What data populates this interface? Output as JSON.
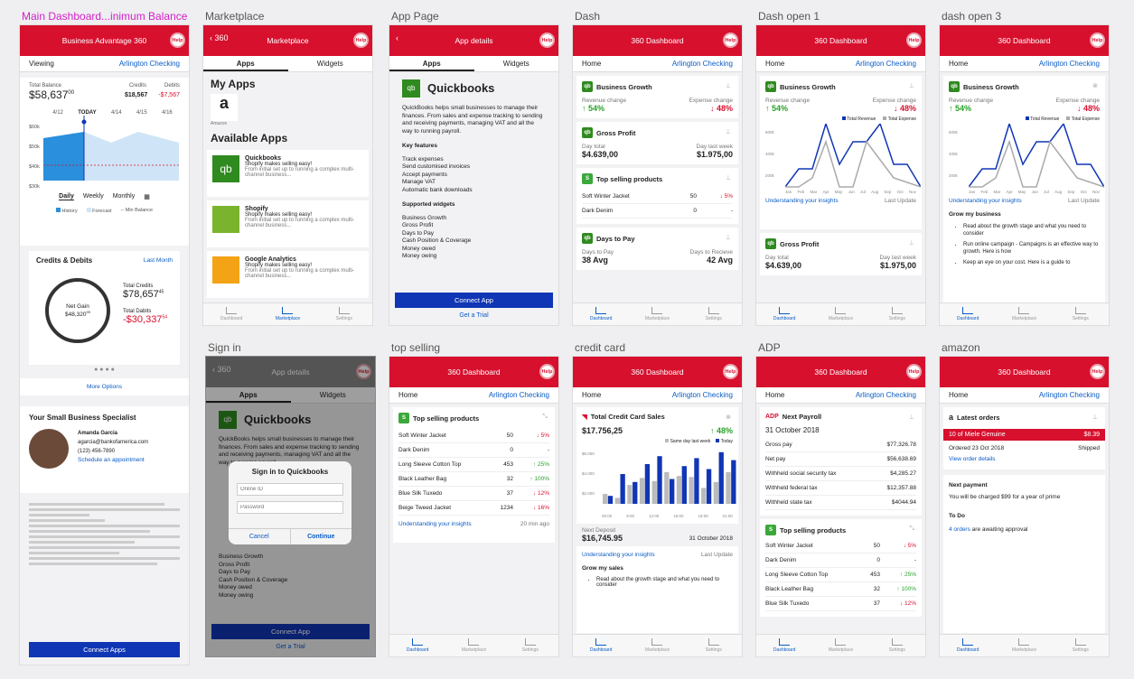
{
  "labels": [
    "Main Dashboard...inimum Balance",
    "Marketplace",
    "App Page",
    "Dash",
    "Dash open 1",
    "dash open 3",
    "Sign in",
    "top selling",
    "credit card",
    "ADP",
    "amazon"
  ],
  "help": "Help",
  "main": {
    "title": "Business Advantage 360",
    "viewing": "Viewing",
    "account": "Arlington Checking",
    "total_balance_label": "Total Balance",
    "total_balance": "$58,637",
    "total_balance_cents": "00",
    "credits_label": "Credits",
    "credits": "$18,567",
    "debits_label": "Debits",
    "debits": "-$7,567",
    "dates": [
      "4/12",
      "TODAY",
      "4/14",
      "4/15",
      "4/16"
    ],
    "yticks": [
      "$60k",
      "$50k",
      "$40k",
      "$30k"
    ],
    "periods": [
      "Daily",
      "Weekly",
      "Monthly"
    ],
    "legend": [
      "History",
      "Forecast",
      "Min Balance"
    ],
    "cd_title": "Credits & Debits",
    "last_month": "Last Month",
    "net_gain_label": "Net Gain",
    "net_gain": "$48,320",
    "net_gain_cents": "99",
    "total_credits_label": "Total Credits",
    "total_credits": "$78,657",
    "total_credits_cents": "45",
    "total_debits_label": "Total Dabits",
    "total_debits": "-$30,337",
    "total_debits_cents": "54",
    "more": "More Options",
    "specialist_title": "Your Small Business Specialist",
    "sp_name": "Amanda Garcia",
    "sp_email": "agarcia@bankofamerica.com",
    "sp_phone": "(123) 456-7890",
    "sp_link": "Schedule an appointment",
    "connect": "Connect Apps"
  },
  "market": {
    "back": "360",
    "title": "Marketplace",
    "tabs": [
      "Apps",
      "Widgets"
    ],
    "my_apps": "My Apps",
    "amazon": "Amazon",
    "available": "Available Apps",
    "apps": [
      {
        "name": "Quickbooks",
        "tag": "Shopify makes selling easy!",
        "desc": "From initial set up to running a complex multi-channel business..."
      },
      {
        "name": "Shopify",
        "tag": "Shopify makes selling easy!",
        "desc": "From initial set up to running a complex multi-channel business..."
      },
      {
        "name": "Google Analytics",
        "tag": "Shopify makes selling easy!",
        "desc": "From initial set up to running a complex multi-channel business..."
      }
    ]
  },
  "nav": [
    "Dashboard",
    "Marketplace",
    "Settings"
  ],
  "apppage": {
    "title": "App details",
    "name": "Quickbooks",
    "desc": "QuickBooks helps small businesses to manage their finances. From sales and expense tracking to sending and receiving payments, managing VAT and all the way to running payroll.",
    "features_title": "Key features",
    "features": [
      "Track expenses",
      "Send customised invoices",
      "Accept payments",
      "Manage VAT",
      "Automatic bank downloads"
    ],
    "widgets_title": "Supported widgets",
    "widgets": [
      "Business Growth",
      "Gross Profit",
      "Days to Pay",
      "Cash Position & Coverage",
      "Money owed",
      "Money owing"
    ],
    "connect": "Connect App",
    "trial": "Get a Trial"
  },
  "dash": {
    "title": "360 Dashboard",
    "home": "Home",
    "account": "Arlington Checking",
    "bg": "Business Growth",
    "rev": "Revenue change",
    "exp": "Expense change",
    "rev_v": "54%",
    "exp_v": "48%",
    "gp": "Gross Profit",
    "day_total": "Day total",
    "day_last": "Day last week",
    "gp_v1": "$4.639,00",
    "gp_v2": "$1.975,00",
    "tsp": "Top selling products",
    "dtp": "Days to Pay",
    "dtp_l1": "Days to Pay",
    "dtp_l2": "Days to Recieve",
    "dtp_v1": "38 Avg",
    "dtp_v2": "42 Avg",
    "legend": [
      "Total Revenue",
      "Total Expense"
    ],
    "yt": [
      "600k",
      "400k",
      "200k"
    ],
    "months": [
      "Jan",
      "Feb",
      "Mar",
      "Apr",
      "May",
      "Jun",
      "Jul",
      "Aug",
      "Sep",
      "Oct",
      "Nov"
    ],
    "insights": "Understanding your insights",
    "last_update": "Last Update",
    "grow": "Grow my business",
    "grow_items": [
      "Read about the growth stage and what you need to consider",
      "Run online campaign - Campaigns is an effective way to growth. Here is how",
      "Keep an eye on your cost. Here is a guide to"
    ]
  },
  "products": [
    {
      "n": "Soft Winter Jacket",
      "q": "50",
      "c": "5%",
      "d": "down"
    },
    {
      "n": "Dark Denim",
      "q": "0",
      "c": "-",
      "d": ""
    },
    {
      "n": "Long Sleeve Cotton Top",
      "q": "453",
      "c": "25%",
      "d": "up"
    },
    {
      "n": "Black Leather Bag",
      "q": "32",
      "c": "100%",
      "d": "up"
    },
    {
      "n": "Blue Silk Tuxedo",
      "q": "37",
      "c": "12%",
      "d": "down"
    },
    {
      "n": "Beige Tweed Jacket",
      "q": "1234",
      "c": "16%",
      "d": "down"
    }
  ],
  "top_ago": "20 min ago",
  "signin": {
    "title": "Sign in to Quickbooks",
    "id": "Online ID",
    "pw": "Password",
    "cancel": "Cancel",
    "cont": "Continue"
  },
  "cc": {
    "title": "Total Credit Card Sales",
    "amount": "$17.756,25",
    "change": "48%",
    "legend": [
      "Same day last week",
      "Today"
    ],
    "yt": [
      "$6.000",
      "$4.000",
      "$2.000"
    ],
    "xt": [
      "00:00",
      "9:00",
      "12:00",
      "15:00",
      "18:00",
      "21:00"
    ],
    "nd": "Next Deposit",
    "nd_v": "$16,745.95",
    "nd_date": "31 October 2018",
    "grow": "Grow my sales",
    "grow_item": "Read about the growth stage and what you need to consider"
  },
  "cc_chart": {
    "type": "bar",
    "series": [
      {
        "name": "Same day last week",
        "values": [
          1000,
          600,
          1900,
          2600,
          2300,
          3200,
          2800,
          2700,
          1600,
          2200,
          3200
        ]
      },
      {
        "name": "Today",
        "values": [
          800,
          3000,
          2200,
          4000,
          4800,
          2500,
          3800,
          4600,
          3500,
          5200,
          4400
        ]
      }
    ]
  },
  "adp": {
    "np": "Next Payroll",
    "date": "31 October 2018",
    "rows": [
      [
        "Gross pay",
        "$77,326.78"
      ],
      [
        "Net pay",
        "$56,638.69"
      ],
      [
        "Withheld social security tax",
        "$4,285.27"
      ],
      [
        "Withheld federal tax",
        "$12,357.88"
      ],
      [
        "Withheld state tax",
        "$4044.94"
      ]
    ]
  },
  "amazon": {
    "title": "Latest orders",
    "item": "10 of Miele Genuine",
    "price": "$8.39",
    "ordered": "Ordered 23 Oct 2018",
    "status": "Shipped",
    "view": "View order details",
    "np": "Next payment",
    "np_text": "You will be charged $99 for a year of prime",
    "todo": "To Do",
    "orders": "4 orders",
    "todo_text": "are awaiting approval"
  }
}
